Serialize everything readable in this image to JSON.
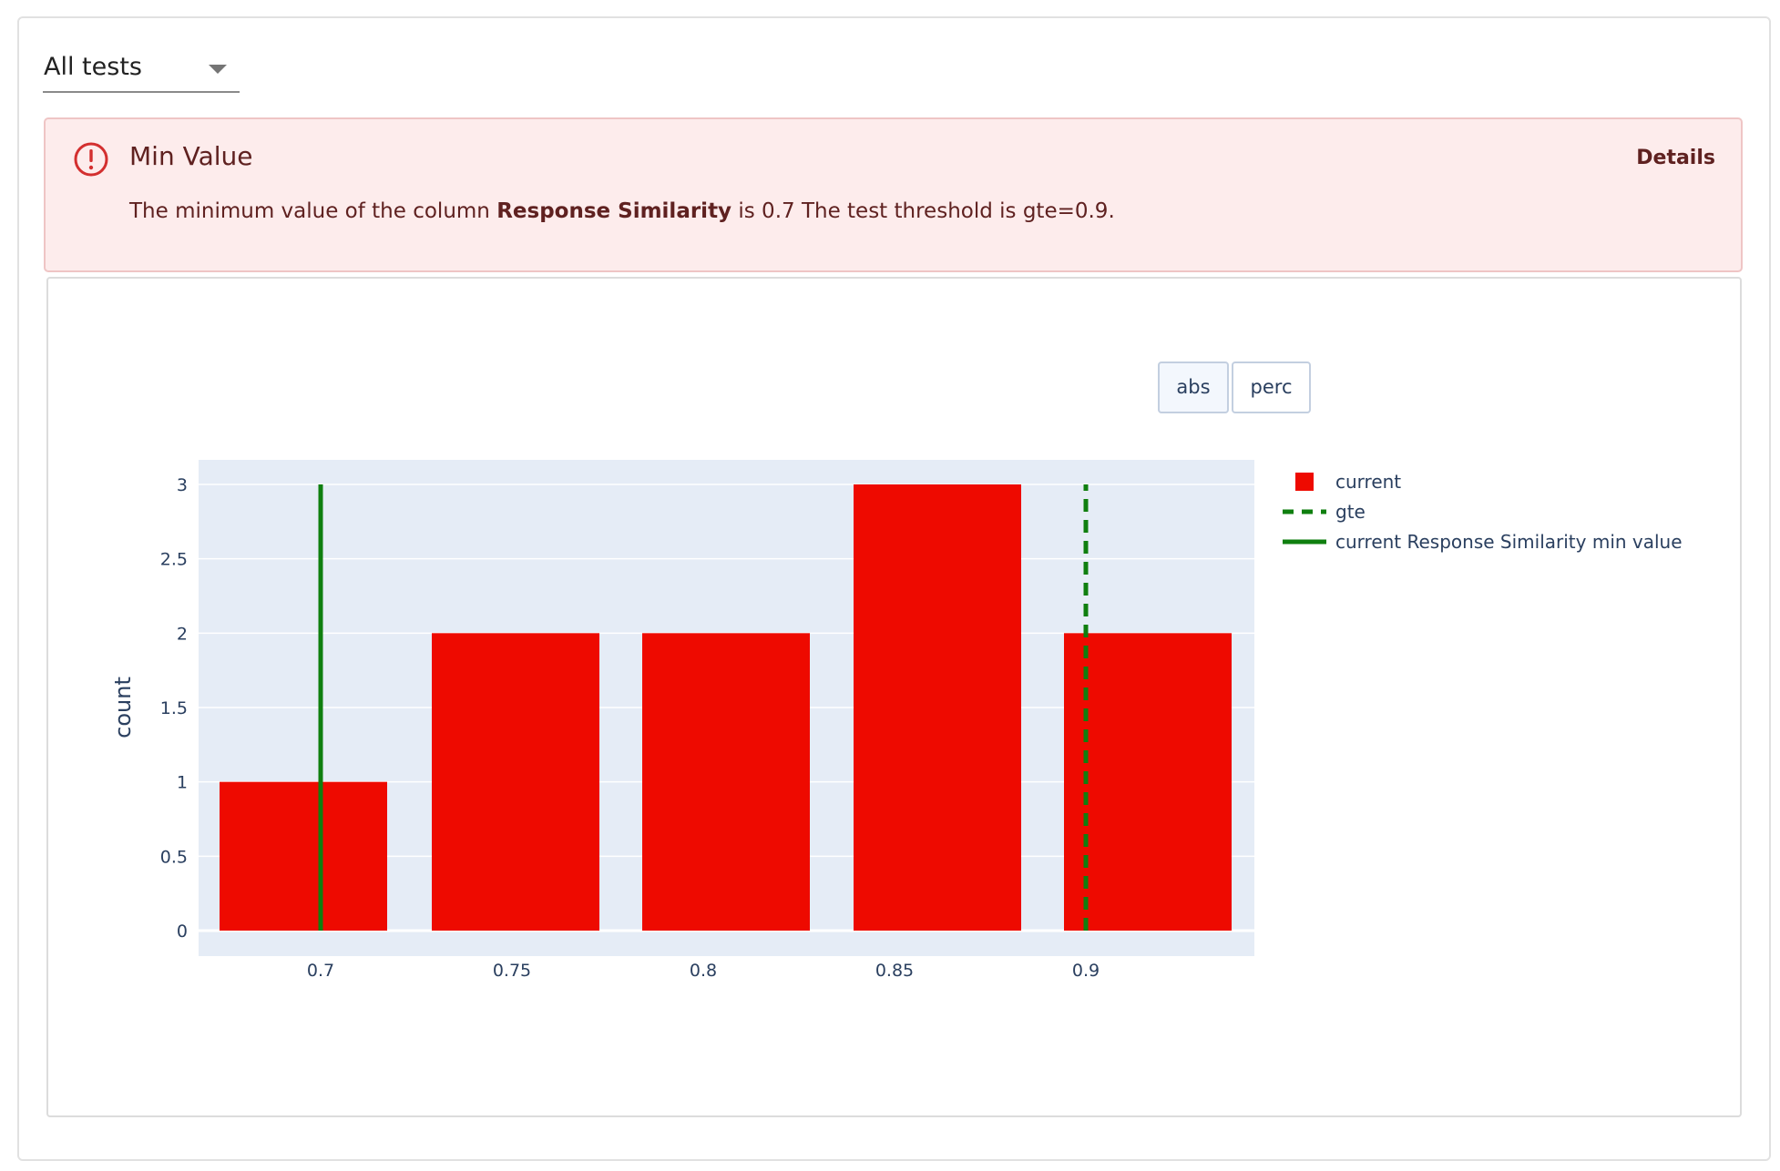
{
  "filter": {
    "selected": "All tests"
  },
  "alert": {
    "title": "Min Value",
    "details_label": "Details",
    "message_prefix": "The minimum value of the column ",
    "message_column": "Response Similarity",
    "message_suffix": " is 0.7 The test threshold is gte=0.9.",
    "icon": "error-circle-icon"
  },
  "chart_controls": {
    "buttons": [
      "abs",
      "perc"
    ],
    "active": "abs"
  },
  "colors": {
    "bar": "#ee0a00",
    "line": "#0f7f0f",
    "plot_bg": "#e5ecf6",
    "alert_bg": "#fdecec",
    "alert_text": "#5f2120",
    "alert_icon": "#d32f2f"
  },
  "chart_data": {
    "type": "bar",
    "categories": [
      "0.7",
      "0.75",
      "0.8",
      "0.85",
      "0.9"
    ],
    "x": [
      0.7,
      0.75,
      0.8,
      0.85,
      0.9
    ],
    "values": [
      1,
      2,
      2,
      3,
      2
    ],
    "ylabel": "count",
    "xlabel": "",
    "ylim": [
      0,
      3
    ],
    "yticks": [
      0,
      0.5,
      1,
      1.5,
      2,
      2.5,
      3
    ],
    "grid": true,
    "legend_position": "right",
    "series": [
      {
        "name": "current",
        "kind": "bar",
        "values": [
          1,
          2,
          2,
          3,
          2
        ]
      },
      {
        "name": "gte",
        "kind": "vertical-line",
        "style": "dashed",
        "x": 0.9,
        "y_range": [
          0,
          3
        ]
      },
      {
        "name": "current Response Similarity min value",
        "kind": "vertical-line",
        "style": "solid",
        "x": 0.7,
        "y_range": [
          0,
          3
        ]
      }
    ]
  }
}
